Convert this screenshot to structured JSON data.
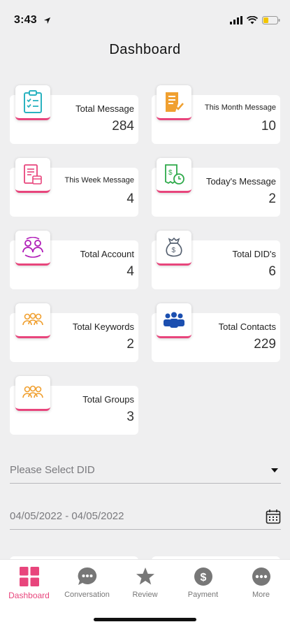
{
  "status_bar": {
    "time": "3:43"
  },
  "header": {
    "title": "Dashboard"
  },
  "cards": [
    {
      "label": "Total Message",
      "value": "284",
      "icon": "clipboard-check-icon"
    },
    {
      "label": "This Month Message",
      "value": "10",
      "icon": "document-check-icon"
    },
    {
      "label": "This Week Message",
      "value": "4",
      "icon": "document-calendar-icon"
    },
    {
      "label": "Today's Message",
      "value": "2",
      "icon": "receipt-clock-icon"
    },
    {
      "label": "Total Account",
      "value": "4",
      "icon": "users-cycle-icon"
    },
    {
      "label": "Total DID's",
      "value": "6",
      "icon": "money-bag-icon"
    },
    {
      "label": "Total Keywords",
      "value": "2",
      "icon": "group-icon"
    },
    {
      "label": "Total Contacts",
      "value": "229",
      "icon": "contacts-group-icon"
    },
    {
      "label": "Total Groups",
      "value": "3",
      "icon": "group-icon"
    }
  ],
  "filters": {
    "did_select": "Please Select DID",
    "date_range": "04/05/2022 - 04/05/2022"
  },
  "tabs": [
    {
      "label": "Dashboard",
      "icon": "grid-icon"
    },
    {
      "label": "Conversation",
      "icon": "chat-icon"
    },
    {
      "label": "Review",
      "icon": "star-icon"
    },
    {
      "label": "Payment",
      "icon": "dollar-icon"
    },
    {
      "label": "More",
      "icon": "more-icon"
    }
  ],
  "colors": {
    "accent": "#e8457c",
    "teal": "#2bb3c0",
    "orange": "#f0a030",
    "pink": "#e8457c",
    "green": "#2eaa4a",
    "purple": "#b01cb8",
    "blue": "#1b4fb0",
    "tab_gray": "#777777"
  }
}
